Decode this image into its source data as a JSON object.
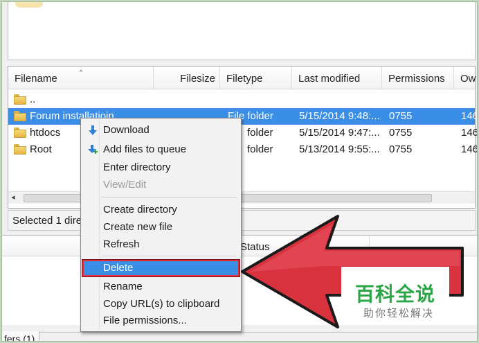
{
  "file_list": {
    "columns": [
      "Filename",
      "Filesize",
      "Filetype",
      "Last modified",
      "Permissions",
      "Ow"
    ],
    "rows": [
      {
        "name": "..",
        "filesize": "",
        "filetype": "",
        "modified": "",
        "permissions": "",
        "owner": "",
        "selected": false
      },
      {
        "name": "Forum installatioin",
        "filesize": "",
        "filetype": "File folder",
        "modified": "5/15/2014 9:48:...",
        "permissions": "0755",
        "owner": "146",
        "selected": true
      },
      {
        "name": "htdocs",
        "filesize": "",
        "filetype": "folder",
        "modified": "5/15/2014 9:47:...",
        "permissions": "0755",
        "owner": "146",
        "selected": false
      },
      {
        "name": "Root",
        "filesize": "",
        "filetype": "folder",
        "modified": "5/13/2014 9:55:...",
        "permissions": "0755",
        "owner": "146",
        "selected": false
      }
    ]
  },
  "status_bar": {
    "text": "Selected 1 dire"
  },
  "queue": {
    "status_header": "Status"
  },
  "bottom_tab": {
    "label": "fers (1)"
  },
  "context_menu": {
    "items": [
      {
        "label": "Download",
        "icon": "download-arrow-icon",
        "disabled": false
      },
      {
        "label": "Add files to queue",
        "icon": "add-to-queue-icon",
        "disabled": false
      },
      {
        "label": "Enter directory",
        "disabled": false
      },
      {
        "label": "View/Edit",
        "disabled": true
      },
      {
        "label": "Create directory",
        "disabled": false
      },
      {
        "label": "Create new file",
        "disabled": false
      },
      {
        "label": "Refresh",
        "disabled": false
      },
      {
        "label": "Delete",
        "disabled": false,
        "highlighted": true
      },
      {
        "label": "Rename",
        "disabled": false
      },
      {
        "label": "Copy URL(s) to clipboard",
        "disabled": false
      },
      {
        "label": "File permissions...",
        "disabled": false
      }
    ]
  },
  "watermark": {
    "title": "百科全说",
    "subtitle": "助你轻松解决"
  },
  "colors": {
    "selection": "#3b8ee6",
    "callout_arrow": "#d8323f",
    "watermark_green": "#2aa646"
  }
}
